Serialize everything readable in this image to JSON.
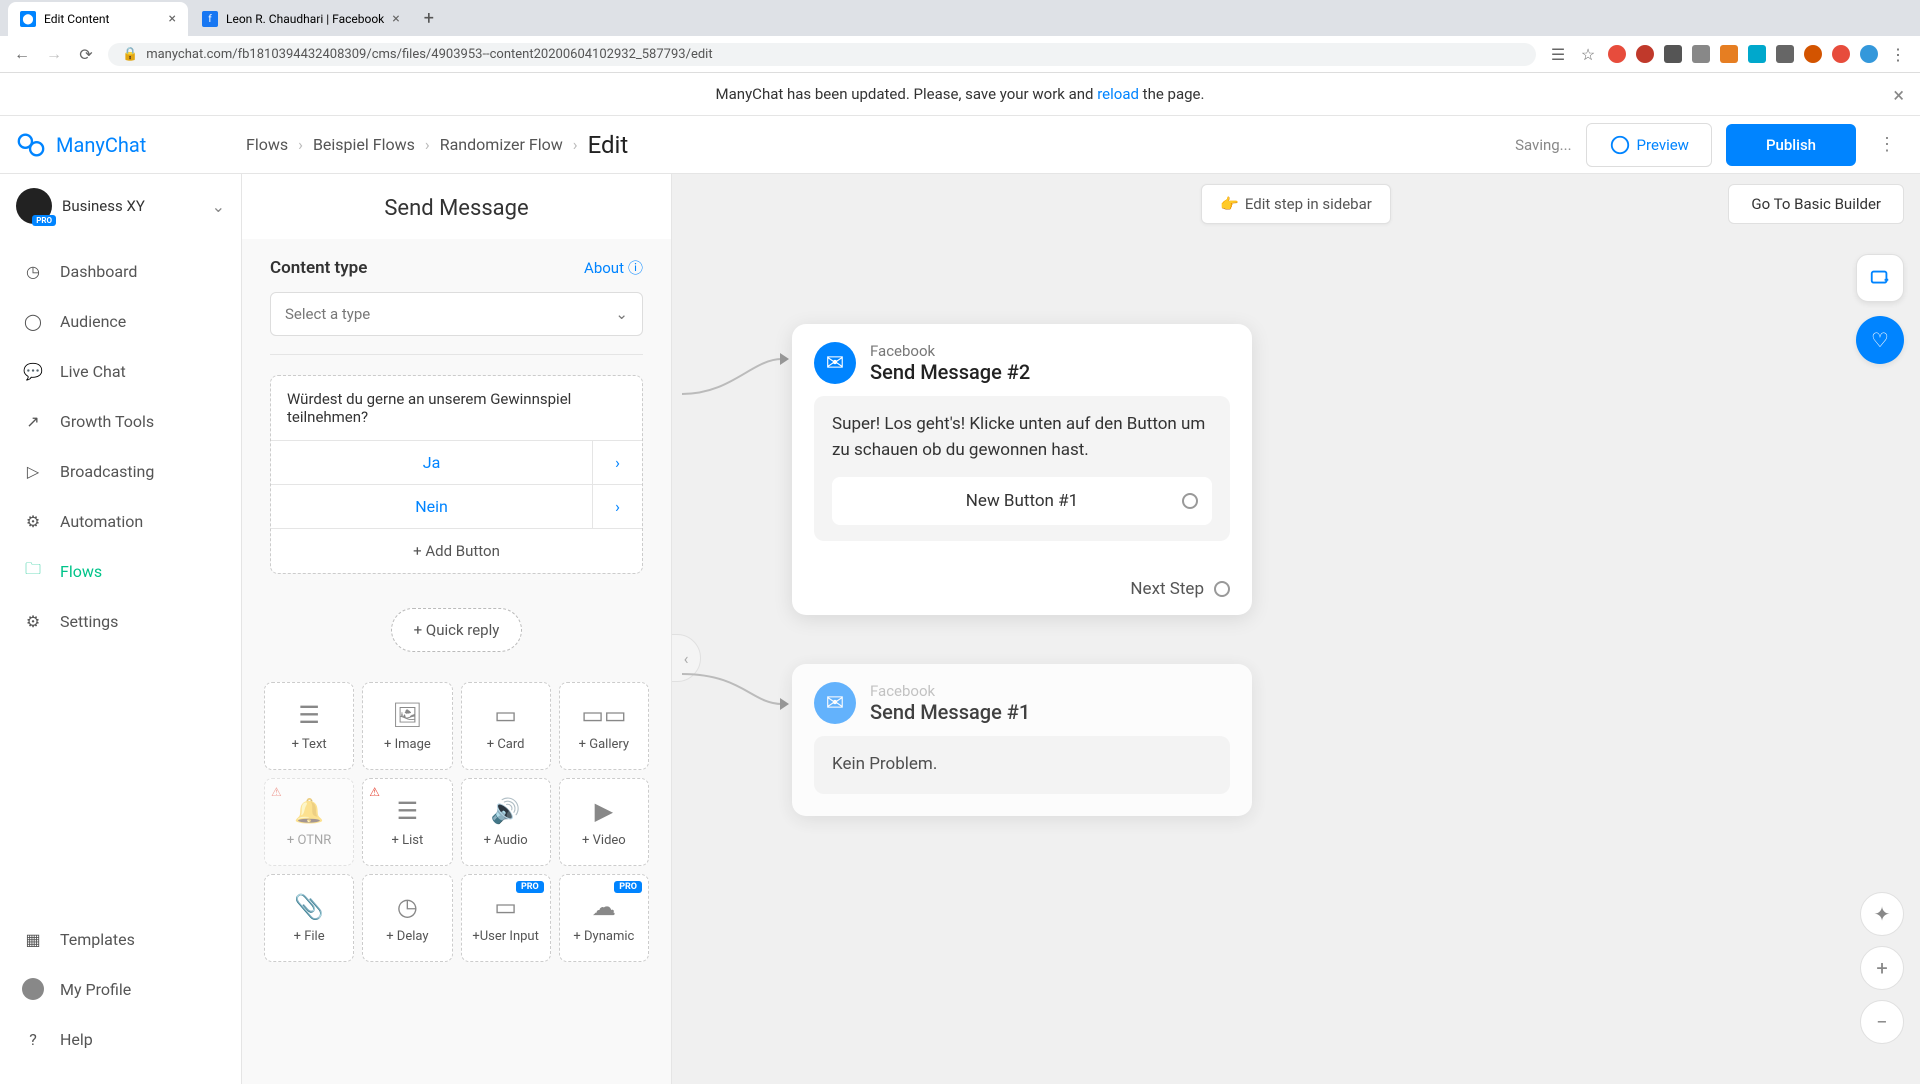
{
  "browser": {
    "tabs": [
      {
        "title": "Edit Content",
        "favicon_color": "#0084ff"
      },
      {
        "title": "Leon R. Chaudhari | Facebook",
        "favicon_color": "#1877f2"
      }
    ],
    "url": "manychat.com/fb181039443240830​9/cms/files/4903953--content20200604102932_587793/edit"
  },
  "banner": {
    "text_before": "ManyChat has been updated. Please, save your work and ",
    "link": "reload",
    "text_after": " the page."
  },
  "logo_text": "ManyChat",
  "breadcrumbs": [
    "Flows",
    "Beispiel Flows",
    "Randomizer Flow"
  ],
  "breadcrumb_current": "Edit",
  "status": "Saving...",
  "buttons": {
    "preview": "Preview",
    "publish": "Publish"
  },
  "account": {
    "name": "Business XY",
    "badge": "PRO"
  },
  "nav": [
    {
      "label": "Dashboard",
      "icon": "gauge"
    },
    {
      "label": "Audience",
      "icon": "user"
    },
    {
      "label": "Live Chat",
      "icon": "chat"
    },
    {
      "label": "Growth Tools",
      "icon": "trend"
    },
    {
      "label": "Broadcasting",
      "icon": "megaphone"
    },
    {
      "label": "Automation",
      "icon": "robot"
    },
    {
      "label": "Flows",
      "icon": "folder",
      "active": true
    },
    {
      "label": "Settings",
      "icon": "gear"
    }
  ],
  "nav_bottom": [
    {
      "label": "Templates",
      "icon": "templates"
    },
    {
      "label": "My Profile",
      "icon": "avatar"
    },
    {
      "label": "Help",
      "icon": "help"
    }
  ],
  "panel": {
    "title": "Send Message",
    "content_type_label": "Content type",
    "about": "About",
    "select_placeholder": "Select a type",
    "message_text": "Würdest du gerne an unserem Gewinnspiel teilnehmen?",
    "buttons": [
      {
        "label": "Ja"
      },
      {
        "label": "Nein"
      }
    ],
    "add_button": "+ Add Button",
    "quick_reply": "+ Quick reply",
    "tiles": [
      {
        "label": "+ Text"
      },
      {
        "label": "+ Image"
      },
      {
        "label": "+ Card"
      },
      {
        "label": "+ Gallery"
      },
      {
        "label": "+ OTNR",
        "disabled": true,
        "warn": true
      },
      {
        "label": "+ List",
        "warn": true
      },
      {
        "label": "+ Audio"
      },
      {
        "label": "+ Video"
      },
      {
        "label": "+ File"
      },
      {
        "label": "+ Delay"
      },
      {
        "label": "+User Input",
        "pro": true
      },
      {
        "label": "+ Dynamic",
        "pro": true
      }
    ]
  },
  "canvas": {
    "edit_sidebar": "Edit step in sidebar",
    "basic_builder": "Go To Basic Builder",
    "node2": {
      "channel": "Facebook",
      "title": "Send Message #2",
      "text": "Super! Los geht's! Klicke unten auf den Button um zu schauen ob du gewonnen hast.",
      "button": "New Button #1",
      "next_step": "Next Step"
    },
    "node1": {
      "channel": "Facebook",
      "title": "Send Message #1",
      "text": "Kein Problem."
    }
  }
}
